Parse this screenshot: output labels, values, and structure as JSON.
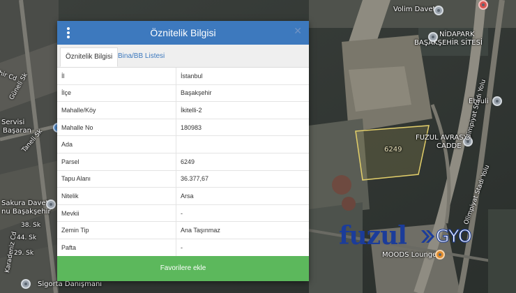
{
  "map": {
    "labels": {
      "volim": "Volim Davet",
      "nidapark": "NİDAPARK",
      "basaksehir_sitesi": "BAŞAKŞEHİR SİTESİ",
      "ebruli": "Ebruli",
      "fuzul_avrasya": "FUZUL AVRASYA",
      "cadde": "CADDE",
      "parcel": "6249",
      "olimpiyat_1": "Olimpiyat Stadı Yolu",
      "olimpiyat_2": "Olimpiyat Stadı Yolu",
      "servisi": "Servisi",
      "basaran": "Başaran",
      "sakura": "Sakura Davet",
      "bahcesehir": "nu Başakşehir",
      "moods": "MOODS Lounge",
      "sigorta": "Sigorta Danışmanı",
      "guncel_sk": "Güneli Sk",
      "taneli_sk": "Taneli Sk",
      "sk_38": "38. Sk",
      "sk_44": "44. Sk",
      "sk_29": "29. Sk",
      "cd_left": "hir Cd",
      "karadeniz": "Karadeniz Cd"
    },
    "colors": {
      "parcel_outline": "#e3cf6a"
    }
  },
  "panel": {
    "title": "Öznitelik Bilgisi",
    "menu_icon": "vertical-dots-icon",
    "close_icon": "close-icon",
    "close_glyph": "✕",
    "tabs": [
      {
        "label": "Öznitelik Bilgisi",
        "active": true
      },
      {
        "label": "Bina/BB Listesi",
        "active": false
      }
    ],
    "rows": [
      {
        "label": "İl",
        "value": "İstanbul"
      },
      {
        "label": "İlçe",
        "value": "Başakşehir"
      },
      {
        "label": "Mahalle/Köy",
        "value": "İkitelli-2"
      },
      {
        "label": "Mahalle No",
        "value": "180983"
      },
      {
        "label": "Ada",
        "value": ""
      },
      {
        "label": "Parsel",
        "value": "6249"
      },
      {
        "label": "Tapu Alanı",
        "value": "36.377,67"
      },
      {
        "label": "Nitelik",
        "value": "Arsa"
      },
      {
        "label": "Mevkii",
        "value": "-"
      },
      {
        "label": "Zemin Tip",
        "value": "Ana Taşınmaz"
      },
      {
        "label": "Pafta",
        "value": "-"
      }
    ],
    "button_label": "Favorilere ekle",
    "colors": {
      "header": "#3d79be",
      "button": "#5cb85c"
    }
  },
  "watermark": {
    "brand": "fuzul",
    "suffix": "GYO",
    "color": "#1b3c9a"
  }
}
